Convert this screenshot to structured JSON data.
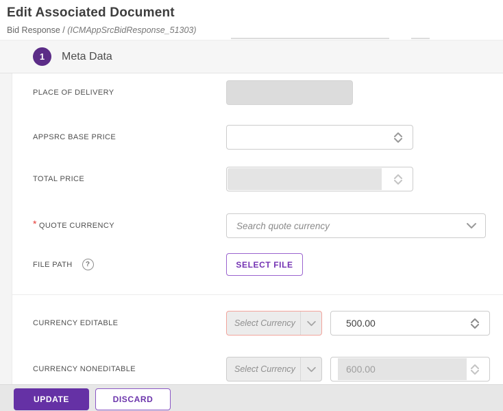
{
  "header": {
    "title": "Edit Associated Document",
    "breadcrumb_prefix": "Bid Response / ",
    "breadcrumb_doc": "(ICMAppSrcBidResponse_51303)"
  },
  "section": {
    "step_number": "1",
    "title": "Meta Data"
  },
  "fields": {
    "place_of_delivery": {
      "label": "PLACE OF DELIVERY",
      "value": ""
    },
    "appsrc_base_price": {
      "label": "APPSRC BASE PRICE",
      "value": ""
    },
    "total_price": {
      "label": "TOTAL PRICE",
      "value": ""
    },
    "quote_currency": {
      "label": "QUOTE CURRENCY",
      "required_marker": "*",
      "placeholder": "Search quote currency"
    },
    "file_path": {
      "label": "FILE PATH",
      "help_glyph": "?",
      "button_label": "SELECT FILE"
    },
    "currency_editable": {
      "label": "CURRENCY EDITABLE",
      "dropdown_placeholder": "Select Currency",
      "amount": "500.00"
    },
    "currency_noneditable": {
      "label": "CURRENCY NONEDITABLE",
      "dropdown_placeholder": "Select Currency",
      "amount": "600.00"
    }
  },
  "footer": {
    "update_label": "UPDATE",
    "discard_label": "DISCARD"
  },
  "colors": {
    "accent_purple": "#6531a5",
    "step_circle_purple": "#5b2c87",
    "error_border": "#f2a49c",
    "required_red": "#e53935"
  }
}
